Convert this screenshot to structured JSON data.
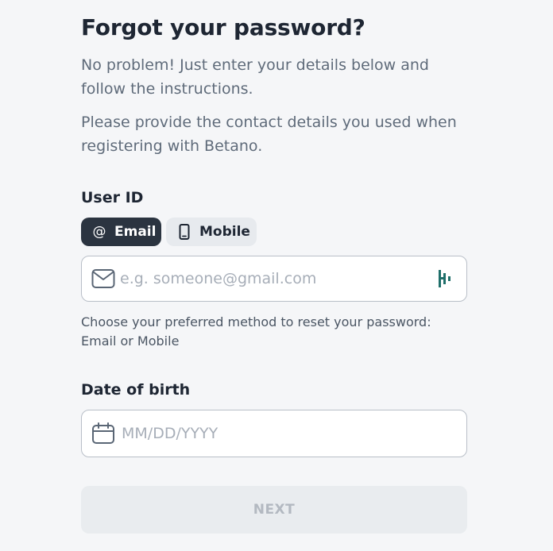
{
  "heading": {
    "title": "Forgot your password?",
    "intro": "No problem! Just enter your details below and follow the instructions.",
    "contact_note": "Please provide the contact details you used when registering with Betano."
  },
  "user_id": {
    "label": "User ID",
    "toggles": [
      {
        "label": "Email",
        "icon": "at-icon",
        "selected": true
      },
      {
        "label": "Mobile",
        "icon": "phone-icon",
        "selected": false
      }
    ],
    "email_placeholder": "e.g. someone@gmail.com",
    "email_value": "",
    "helper_text": "Choose your preferred method to reset your password: Email or Mobile"
  },
  "dob": {
    "label": "Date of birth",
    "placeholder": "MM/DD/YYYY",
    "value": ""
  },
  "actions": {
    "next_label": "NEXT",
    "next_enabled": false
  },
  "colors": {
    "background": "#f5f6f8",
    "toggle_selected": "#2b3440",
    "toggle_unselected": "#e7eaee",
    "autofill_icon": "#1f6f6a",
    "button_disabled_bg": "#e9ecef",
    "button_disabled_text": "#b3b9c1"
  }
}
